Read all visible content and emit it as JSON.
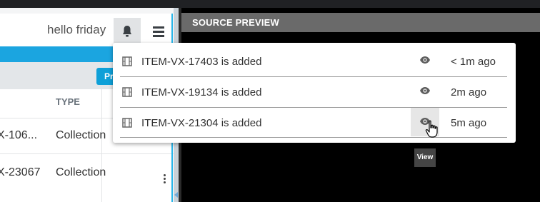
{
  "header": {
    "greeting": "hello friday",
    "bell_icon": "bell-icon",
    "menu_icon": "hamburger-menu-icon"
  },
  "toolbar": {
    "primary_button_label": "Pr"
  },
  "table": {
    "columns": [
      "TYPE"
    ],
    "rows": [
      {
        "id": "X-106...",
        "type": "Collection"
      },
      {
        "id": "X-23067",
        "type": "Collection"
      }
    ]
  },
  "source_preview": {
    "title": "SOURCE PREVIEW"
  },
  "notifications": [
    {
      "text": "ITEM-VX-17403 is added",
      "time": "< 1m ago"
    },
    {
      "text": "ITEM-VX-19134 is added",
      "time": "2m ago"
    },
    {
      "text": "ITEM-VX-21304 is added",
      "time": "5m ago"
    }
  ],
  "tooltip": {
    "text": "View"
  },
  "colors": {
    "accent_blue": "#1ba5e0",
    "preview_header": "#6a6a6a"
  }
}
